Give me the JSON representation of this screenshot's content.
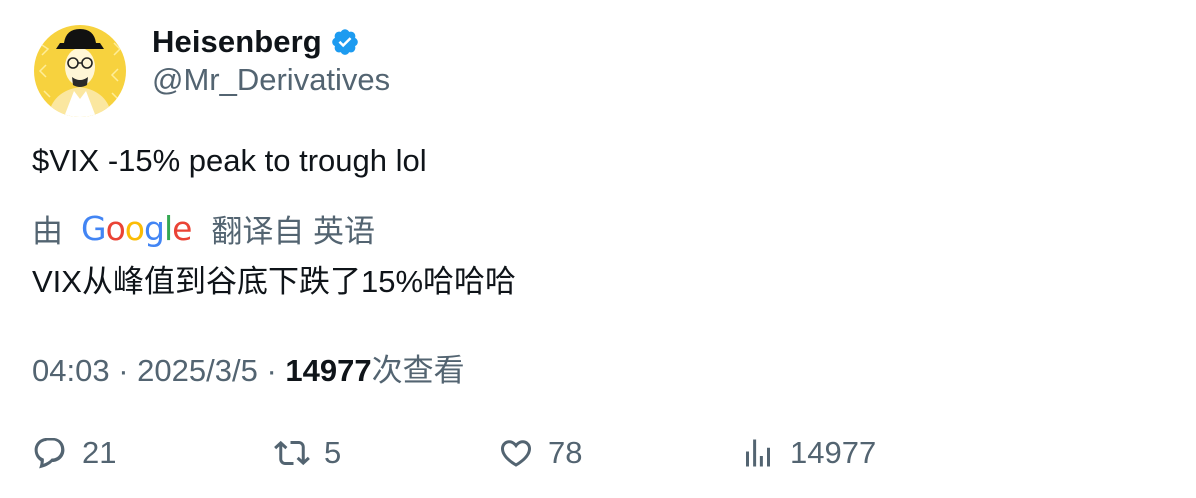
{
  "author": {
    "display_name": "Heisenberg",
    "handle": "@Mr_Derivatives",
    "verified": true,
    "avatar_icon": "heisenberg-avatar",
    "avatar_bg": "#f7d23e"
  },
  "tweet": {
    "text": "$VIX -15% peak to trough lol"
  },
  "translation": {
    "by_label": "由",
    "provider": "Google",
    "label": "翻译自 英语",
    "text": "VIX从峰值到谷底下跌了15%哈哈哈"
  },
  "meta": {
    "time": "04:03",
    "separator": "·",
    "date": "2025/3/5",
    "views_count": "14977",
    "views_suffix": "次查看"
  },
  "actions": {
    "reply": {
      "icon": "reply-icon",
      "count": "21"
    },
    "retweet": {
      "icon": "retweet-icon",
      "count": "5"
    },
    "like": {
      "icon": "heart-icon",
      "count": "78"
    },
    "views": {
      "icon": "views-chart-icon",
      "count": "14977"
    }
  },
  "colors": {
    "primary_text": "#0f1419",
    "secondary_text": "#536471",
    "verified_blue": "#1d9bf0",
    "google_blue": "#4285F4",
    "google_red": "#EA4335",
    "google_yellow": "#FBBC05",
    "google_green": "#34A853"
  }
}
